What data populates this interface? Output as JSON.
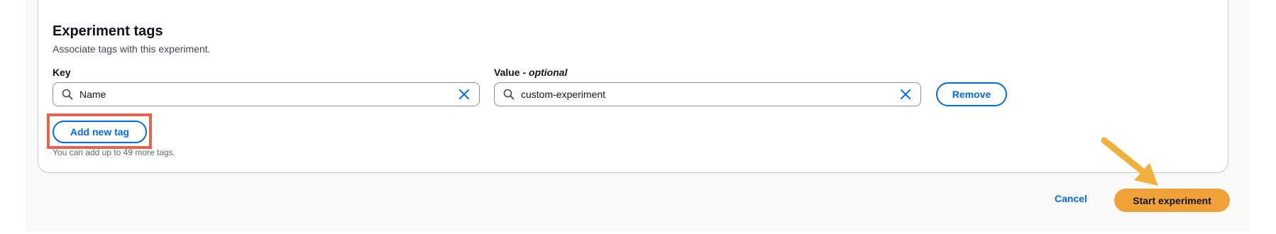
{
  "section": {
    "title": "Experiment tags",
    "description": "Associate tags with this experiment."
  },
  "tags": {
    "key_label": "Key",
    "value_label_main": "Value - ",
    "value_label_optional": "optional",
    "rows": [
      {
        "key": "Name",
        "value": "custom-experiment",
        "remove_label": "Remove"
      }
    ],
    "add_label": "Add new tag",
    "hint": "You can add up to 49 more tags."
  },
  "footer": {
    "cancel_label": "Cancel",
    "submit_label": "Start experiment"
  },
  "annotations": {
    "highlight_color": "#e6634f",
    "arrow_color": "#f0b13c"
  },
  "colors": {
    "accent": "#006ce0",
    "primary_button": "#f0a138"
  },
  "icons": [
    "search-icon",
    "close-icon",
    "arrow-annotation-icon"
  ]
}
